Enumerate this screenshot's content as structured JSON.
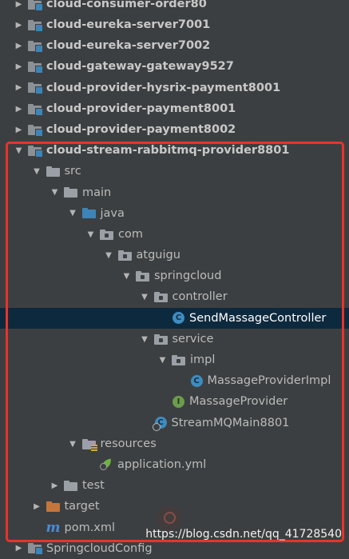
{
  "tree": {
    "items": [
      {
        "label": "cloud-consumer-order80",
        "indent": 0,
        "arrow": "collapsed",
        "icon": "module-folder-icon",
        "bold": true
      },
      {
        "label": "cloud-eureka-server7001",
        "indent": 0,
        "arrow": "collapsed",
        "icon": "module-folder-icon",
        "bold": true
      },
      {
        "label": "cloud-eureka-server7002",
        "indent": 0,
        "arrow": "collapsed",
        "icon": "module-folder-icon",
        "bold": true
      },
      {
        "label": "cloud-gateway-gateway9527",
        "indent": 0,
        "arrow": "collapsed",
        "icon": "module-folder-icon",
        "bold": true
      },
      {
        "label": "cloud-provider-hysrix-payment8001",
        "indent": 0,
        "arrow": "collapsed",
        "icon": "module-folder-icon",
        "bold": true
      },
      {
        "label": "cloud-provider-payment8001",
        "indent": 0,
        "arrow": "collapsed",
        "icon": "module-folder-icon",
        "bold": true
      },
      {
        "label": "cloud-provider-payment8002",
        "indent": 0,
        "arrow": "collapsed",
        "icon": "module-folder-icon",
        "bold": true
      },
      {
        "label": "cloud-stream-rabbitmq-provider8801",
        "indent": 0,
        "arrow": "expanded",
        "icon": "module-folder-icon",
        "bold": true
      },
      {
        "label": "src",
        "indent": 1,
        "arrow": "expanded",
        "icon": "folder-icon"
      },
      {
        "label": "main",
        "indent": 2,
        "arrow": "expanded",
        "icon": "folder-icon"
      },
      {
        "label": "java",
        "indent": 3,
        "arrow": "expanded",
        "icon": "source-folder-icon"
      },
      {
        "label": "com",
        "indent": 4,
        "arrow": "expanded",
        "icon": "package-icon"
      },
      {
        "label": "atguigu",
        "indent": 5,
        "arrow": "expanded",
        "icon": "package-icon"
      },
      {
        "label": "springcloud",
        "indent": 6,
        "arrow": "expanded",
        "icon": "package-icon"
      },
      {
        "label": "controller",
        "indent": 7,
        "arrow": "expanded",
        "icon": "package-icon"
      },
      {
        "label": "SendMassageController",
        "indent": 8,
        "arrow": "none",
        "icon": "class-icon",
        "selected": true
      },
      {
        "label": "service",
        "indent": 7,
        "arrow": "expanded",
        "icon": "package-icon"
      },
      {
        "label": "impl",
        "indent": 8,
        "arrow": "expanded",
        "icon": "package-icon"
      },
      {
        "label": "MassageProviderImpl",
        "indent": 9,
        "arrow": "none",
        "icon": "class-icon"
      },
      {
        "label": "MassageProvider",
        "indent": 8,
        "arrow": "none",
        "icon": "interface-icon"
      },
      {
        "label": "StreamMQMain8801",
        "indent": 7,
        "arrow": "none",
        "icon": "spring-boot-main-class-icon"
      },
      {
        "label": "resources",
        "indent": 3,
        "arrow": "expanded",
        "icon": "resources-folder-icon"
      },
      {
        "label": "application.yml",
        "indent": 4,
        "arrow": "none",
        "icon": "spring-config-icon"
      },
      {
        "label": "test",
        "indent": 2,
        "arrow": "collapsed",
        "icon": "folder-icon"
      },
      {
        "label": "target",
        "indent": 1,
        "arrow": "collapsed",
        "icon": "excluded-folder-icon"
      },
      {
        "label": "pom.xml",
        "indent": 1,
        "arrow": "none",
        "icon": "maven-icon"
      },
      {
        "label": "SpringcloudConfig",
        "indent": 0,
        "arrow": "collapsed",
        "icon": "module-folder-icon"
      }
    ]
  },
  "watermark": "https://blog.csdn.net/qq_41728540",
  "colors": {
    "background": "#3c3f41",
    "selection": "#0d293e",
    "highlight_border": "#e8332a"
  }
}
